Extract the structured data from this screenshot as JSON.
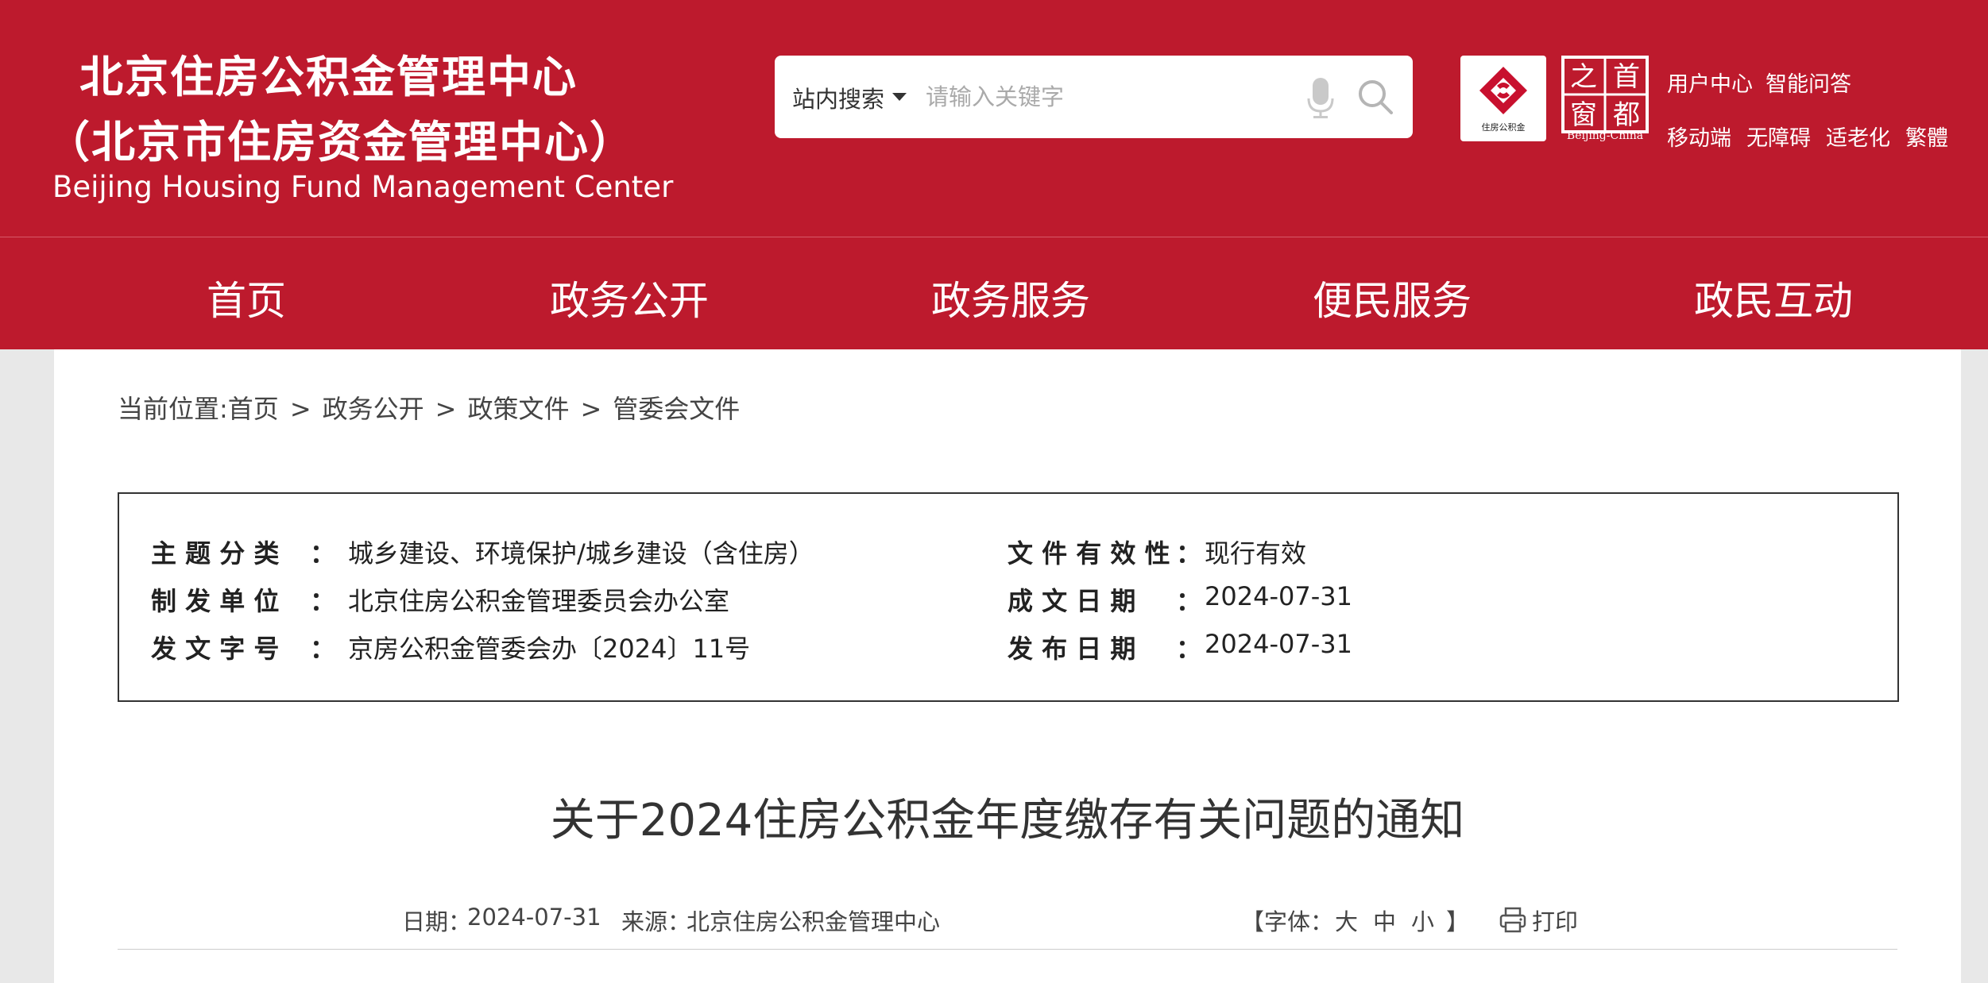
{
  "header": {
    "title_cn": "北京住房公积金管理中心",
    "title_cn_alt": "（北京市住房资金管理中心）",
    "title_en": "Beijing Housing Fund Management Center",
    "search": {
      "scope": "站内搜索",
      "placeholder": "请输入关键字"
    },
    "logos": {
      "fund_text": "住房公积金",
      "capital_chars": [
        "之",
        "首",
        "窗",
        "都"
      ],
      "capital_en": "Beijing-China"
    },
    "links_row1": [
      "用户中心",
      "智能问答"
    ],
    "links_row2": [
      "移动端",
      "无障碍",
      "适老化",
      "繁體"
    ]
  },
  "nav": {
    "items": [
      "首页",
      "政务公开",
      "政务服务",
      "便民服务",
      "政民互动"
    ]
  },
  "breadcrumb": {
    "prefix": "当前位置:",
    "items": [
      "首页",
      "政务公开",
      "政策文件",
      "管委会文件"
    ],
    "separator": ">"
  },
  "meta": {
    "left": [
      {
        "label": "主 题 分 类",
        "value": "城乡建设、环境保护/城乡建设（含住房）"
      },
      {
        "label": "制 发 单 位",
        "value": "北京住房公积金管理委员会办公室"
      },
      {
        "label": "发 文 字 号",
        "value": "京房公积金管委会办〔2024〕11号"
      }
    ],
    "right": [
      {
        "label": "文 件 有 效 性",
        "value": "现行有效"
      },
      {
        "label": "成 文 日 期",
        "value": "2024-07-31"
      },
      {
        "label": "发 布 日 期",
        "value": "2024-07-31"
      }
    ],
    "colon": "："
  },
  "document": {
    "title": "关于2024住房公积金年度缴存有关问题的通知",
    "date_label": "日期：",
    "date": "2024-07-31",
    "source_label": "来源：",
    "source": "北京住房公积金管理中心",
    "font_label_open": "【字体：",
    "font_large": "大",
    "font_medium": "中",
    "font_small": "小",
    "font_label_close": "】",
    "print": "打印"
  },
  "colors": {
    "brand_red": "#bd1a2d",
    "background": "#e8e8e8"
  }
}
